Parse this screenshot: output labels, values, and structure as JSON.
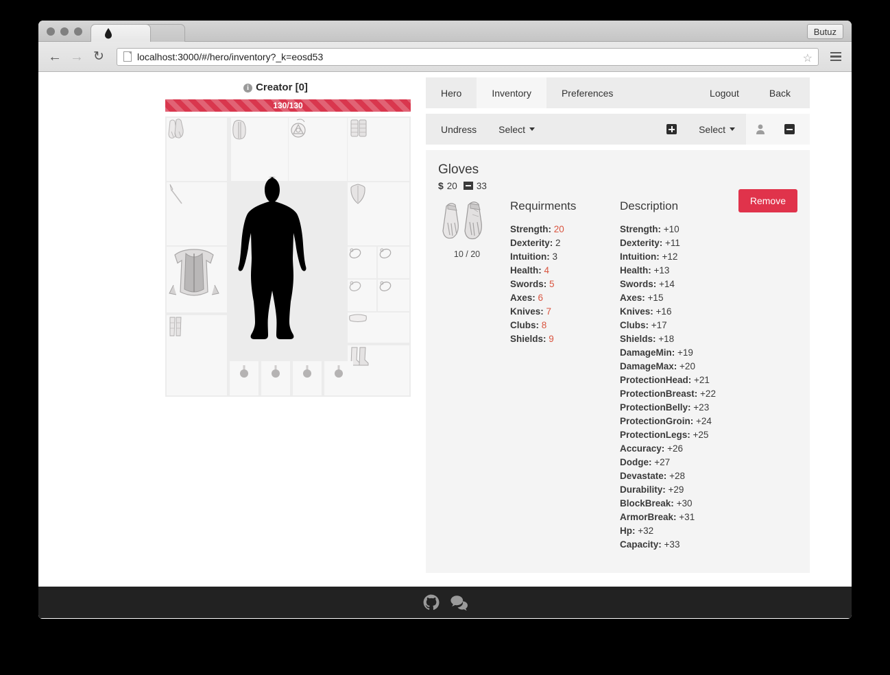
{
  "browser": {
    "butuz_label": "Butuz",
    "url": "localhost:3000/#/hero/inventory?_k=eosd53",
    "back_icon": "back-arrow-icon",
    "forward_icon": "forward-arrow-icon",
    "reload_icon": "reload-icon",
    "star_icon": "bookmark-star-icon",
    "menu_icon": "hamburger-menu-icon"
  },
  "hero": {
    "title": "Creator [0]",
    "health_label": "130/130",
    "health_percent": 100,
    "health_color": "#d9374e"
  },
  "equipment": {
    "slots": [
      {
        "name": "gloves-slot",
        "icon": "gloves-icon",
        "filled": true
      },
      {
        "name": "helmet-slot",
        "icon": "helmet-icon",
        "filled": true
      },
      {
        "name": "amulet-slot",
        "icon": "amulet-icon",
        "filled": true
      },
      {
        "name": "bracers-slot",
        "icon": "bracers-icon",
        "filled": true
      },
      {
        "name": "weapon-slot",
        "icon": "spear-icon",
        "filled": true
      },
      {
        "name": "shield-slot",
        "icon": "shield-icon",
        "filled": true
      },
      {
        "name": "armor-slot",
        "icon": "breastplate-icon",
        "filled": true
      },
      {
        "name": "ring-slot-1",
        "icon": "ring-icon",
        "filled": true
      },
      {
        "name": "ring-slot-2",
        "icon": "ring-icon",
        "filled": true
      },
      {
        "name": "ring-slot-3",
        "icon": "ring-icon",
        "filled": true
      },
      {
        "name": "ring-slot-4",
        "icon": "ring-icon",
        "filled": true
      },
      {
        "name": "belt-slot",
        "icon": "belt-icon",
        "filled": true
      },
      {
        "name": "leggings-slot",
        "icon": "leggings-icon",
        "filled": true
      },
      {
        "name": "boots-slot",
        "icon": "boots-icon",
        "filled": true
      },
      {
        "name": "potion-slot-1",
        "icon": "potion-icon",
        "filled": true
      },
      {
        "name": "potion-slot-2",
        "icon": "potion-icon",
        "filled": true
      },
      {
        "name": "potion-slot-3",
        "icon": "potion-icon",
        "filled": true
      },
      {
        "name": "potion-slot-4",
        "icon": "potion-icon",
        "filled": true
      }
    ]
  },
  "nav_tabs": [
    {
      "label": "Hero",
      "active": false
    },
    {
      "label": "Inventory",
      "active": true
    },
    {
      "label": "Preferences",
      "active": false
    }
  ],
  "nav_right": [
    {
      "label": "Logout"
    },
    {
      "label": "Back"
    }
  ],
  "toolbar": {
    "undress_label": "Undress",
    "select_left_label": "Select",
    "add_icon": "plus-square-icon",
    "select_right_label": "Select",
    "user_icon": "user-icon",
    "remove_icon": "minus-square-icon"
  },
  "item": {
    "name": "Gloves",
    "price": "20",
    "weight": "33",
    "durability": "10 / 20",
    "thumb_icon": "gauntlets-icon",
    "remove_label": "Remove",
    "remove_color": "#e0334b",
    "requirements_heading": "Requirments",
    "description_heading": "Description",
    "requirements": [
      {
        "label": "Strength:",
        "value": "20",
        "red": true
      },
      {
        "label": "Dexterity:",
        "value": "2",
        "red": false
      },
      {
        "label": "Intuition:",
        "value": "3",
        "red": false
      },
      {
        "label": "Health:",
        "value": "4",
        "red": true
      },
      {
        "label": "Swords:",
        "value": "5",
        "red": true
      },
      {
        "label": "Axes:",
        "value": "6",
        "red": true
      },
      {
        "label": "Knives:",
        "value": "7",
        "red": true
      },
      {
        "label": "Clubs:",
        "value": "8",
        "red": true
      },
      {
        "label": "Shields:",
        "value": "9",
        "red": true
      }
    ],
    "description": [
      {
        "label": "Strength:",
        "value": "+10"
      },
      {
        "label": "Dexterity:",
        "value": "+11"
      },
      {
        "label": "Intuition:",
        "value": "+12"
      },
      {
        "label": "Health:",
        "value": "+13"
      },
      {
        "label": "Swords:",
        "value": "+14"
      },
      {
        "label": "Axes:",
        "value": "+15"
      },
      {
        "label": "Knives:",
        "value": "+16"
      },
      {
        "label": "Clubs:",
        "value": "+17"
      },
      {
        "label": "Shields:",
        "value": "+18"
      },
      {
        "label": "DamageMin:",
        "value": "+19"
      },
      {
        "label": "DamageMax:",
        "value": "+20"
      },
      {
        "label": "ProtectionHead:",
        "value": "+21"
      },
      {
        "label": "ProtectionBreast:",
        "value": "+22"
      },
      {
        "label": "ProtectionBelly:",
        "value": "+23"
      },
      {
        "label": "ProtectionGroin:",
        "value": "+24"
      },
      {
        "label": "ProtectionLegs:",
        "value": "+25"
      },
      {
        "label": "Accuracy:",
        "value": "+26"
      },
      {
        "label": "Dodge:",
        "value": "+27"
      },
      {
        "label": "Devastate:",
        "value": "+28"
      },
      {
        "label": "Durability:",
        "value": "+29"
      },
      {
        "label": "BlockBreak:",
        "value": "+30"
      },
      {
        "label": "ArmorBreak:",
        "value": "+31"
      },
      {
        "label": "Hp:",
        "value": "+32"
      },
      {
        "label": "Capacity:",
        "value": "+33"
      }
    ]
  },
  "footer": {
    "icons": [
      {
        "name": "github-icon"
      },
      {
        "name": "comments-icon"
      }
    ]
  }
}
